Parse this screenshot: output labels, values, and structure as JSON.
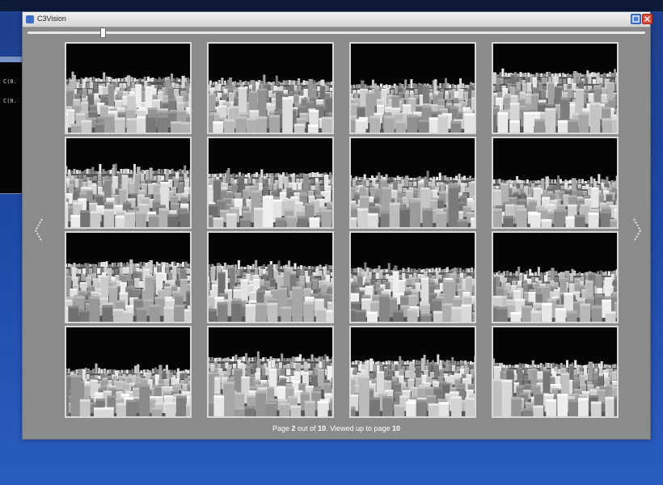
{
  "window": {
    "title": "C3Vision",
    "icon": "app-icon"
  },
  "console": {
    "lines": [
      "C(0.",
      "C(0."
    ]
  },
  "viewer": {
    "slider_value": 0.12,
    "prev_icon": "chevron-left-icon",
    "next_icon": "chevron-right-icon",
    "thumbnails": [
      {
        "variant": 1
      },
      {
        "variant": 2
      },
      {
        "variant": 3
      },
      {
        "variant": 4
      },
      {
        "variant": 5
      },
      {
        "variant": 6
      },
      {
        "variant": 7
      },
      {
        "variant": 8
      },
      {
        "variant": 9
      },
      {
        "variant": 10
      },
      {
        "variant": 11
      },
      {
        "variant": 12
      },
      {
        "variant": 13
      },
      {
        "variant": 14
      },
      {
        "variant": 15
      },
      {
        "variant": 16
      }
    ]
  },
  "footer": {
    "prefix": "Page",
    "current_page": "2",
    "mid1": "out of",
    "total_pages": "10",
    "mid2": ". Viewed up to page",
    "viewed_page": "10"
  },
  "colors": {
    "desktop": "#1d47a3",
    "window_bg": "#8b8b8b",
    "thumb_border": "#d9d9d9"
  }
}
